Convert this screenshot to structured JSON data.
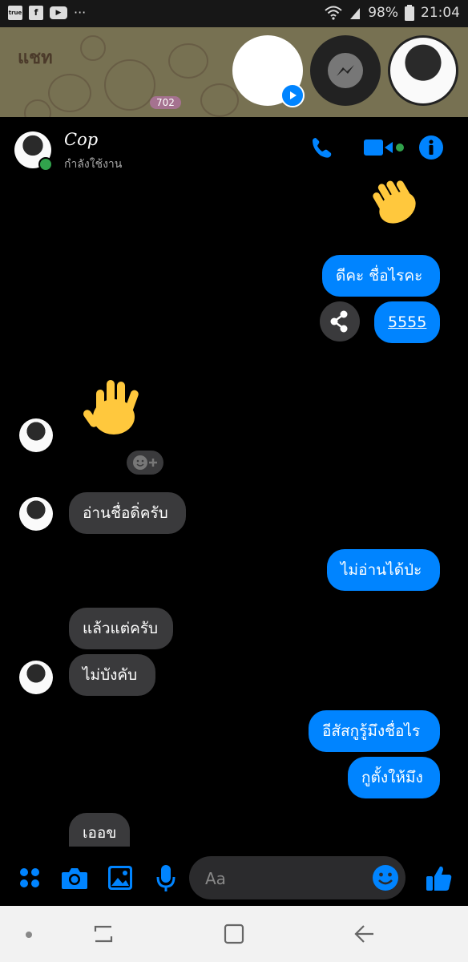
{
  "status_bar": {
    "carrier": "true",
    "facebook_icon": "f",
    "youtube_icon": "▶",
    "more": "···",
    "battery": "98%",
    "time": "21:04"
  },
  "background_app": {
    "title": "แชท",
    "badge": "702"
  },
  "chat_header": {
    "name": "Cop",
    "status": "กำลังใช้งาน"
  },
  "messages": [
    {
      "side": "out",
      "type": "emoji",
      "text": "wave"
    },
    {
      "side": "out",
      "type": "text",
      "text": "ดีคะ ชื่อไรคะ"
    },
    {
      "side": "out",
      "type": "link",
      "text": "5555"
    },
    {
      "side": "in",
      "type": "emoji",
      "text": "wave"
    },
    {
      "side": "in",
      "type": "text",
      "text": "อ่านชื่อดิ่ครับ"
    },
    {
      "side": "out",
      "type": "text",
      "text": "ไม่อ่านได้ป่ะ"
    },
    {
      "side": "in",
      "type": "text",
      "text": "แล้วแต่ครับ"
    },
    {
      "side": "in",
      "type": "text",
      "text": "ไม่บังคับ"
    },
    {
      "side": "out",
      "type": "text",
      "text": "อีสัสกูรู้มึงชื่อไร"
    },
    {
      "side": "out",
      "type": "text",
      "text": "กูตั้งให้มึง"
    },
    {
      "side": "in",
      "type": "text",
      "text": "เออข"
    }
  ],
  "composer": {
    "placeholder": "Aa"
  },
  "colors": {
    "accent": "#0084ff",
    "incoming_bubble": "#3a3a3c",
    "online": "#31a24c"
  },
  "icons": [
    "grid-icon",
    "camera-icon",
    "gallery-icon",
    "mic-icon",
    "emoji-icon",
    "like-icon",
    "phone-icon",
    "video-icon",
    "info-icon",
    "share-icon",
    "messenger-icon"
  ]
}
